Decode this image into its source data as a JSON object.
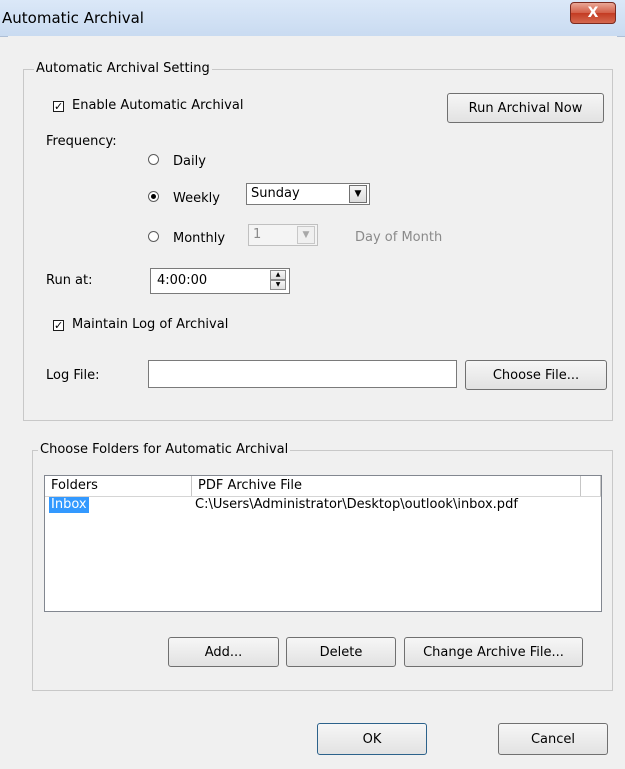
{
  "window": {
    "title": "Automatic Archival",
    "close_glyph": "X"
  },
  "archival_setting": {
    "group_label": "Automatic Archival Setting",
    "enable_label": "Enable Automatic Archival",
    "enable_checked": true,
    "run_now_label": "Run Archival Now",
    "frequency_label": "Frequency:",
    "frequency_options": [
      {
        "label": "Daily",
        "selected": false
      },
      {
        "label": "Weekly",
        "selected": true
      },
      {
        "label": "Monthly",
        "selected": false
      }
    ],
    "weekly_day": "Sunday",
    "monthly_day": "1",
    "day_of_month_label": "Day of Month",
    "run_at_label": "Run at:",
    "run_at_value": "4:00:00",
    "maintain_log_label": "Maintain Log of Archival",
    "maintain_log_checked": true,
    "log_file_label": "Log File:",
    "log_file_value": "",
    "choose_file_label": "Choose File..."
  },
  "folders": {
    "group_label": "Choose Folders for Automatic Archival",
    "columns": [
      "Folders",
      "PDF Archive File"
    ],
    "rows": [
      {
        "folder": "Inbox",
        "archive_file": "C:\\Users\\Administrator\\Desktop\\outlook\\inbox.pdf",
        "selected": true
      }
    ],
    "add_label": "Add...",
    "delete_label": "Delete",
    "change_label": "Change Archive File..."
  },
  "footer": {
    "ok_label": "OK",
    "cancel_label": "Cancel"
  },
  "colors": {
    "selection": "#3399ff",
    "close_button": "#c9452d",
    "titlebar": "#d2e2f5"
  }
}
